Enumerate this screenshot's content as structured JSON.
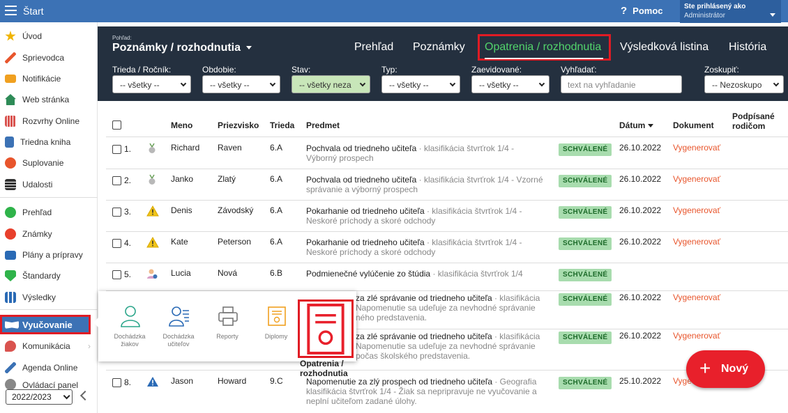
{
  "topbar": {
    "start": "Štart",
    "help": "Pomoc",
    "user_line1": "Ste prihlásený ako",
    "user_line2": "Administrátor"
  },
  "sidebar": {
    "items": [
      {
        "label": "Úvod",
        "icon": "star-icon",
        "color": "#f0b400"
      },
      {
        "label": "Sprievodca",
        "icon": "wand-icon",
        "color": "#e8552c"
      },
      {
        "label": "Notifikácie",
        "icon": "envelope-icon",
        "color": "#f0a020"
      },
      {
        "label": "Web stránka",
        "icon": "home-icon",
        "color": "#2e8b57"
      },
      {
        "label": "Rozvrhy Online",
        "icon": "timetable-icon",
        "color": "#d9534f"
      },
      {
        "label": "Triedna kniha",
        "icon": "book-icon",
        "color": "#3c72b5"
      },
      {
        "label": "Suplovanie",
        "icon": "user-swap-icon",
        "color": "#e8552c"
      },
      {
        "label": "Udalosti",
        "icon": "calendar-icon",
        "color": "#333"
      },
      {
        "label": "Prehľad",
        "icon": "check-circle-icon",
        "color": "#2fb34a"
      },
      {
        "label": "Známky",
        "icon": "grade-icon",
        "color": "#e8402c"
      },
      {
        "label": "Plány a prípravy",
        "icon": "briefcase-icon",
        "color": "#2a6ab5"
      },
      {
        "label": "Štandardy",
        "icon": "shield-check-icon",
        "color": "#2fb34a"
      },
      {
        "label": "Výsledky",
        "icon": "bar-chart-icon",
        "color": "#2a6ab5"
      },
      {
        "label": "Vyučovanie",
        "icon": "open-book-icon",
        "color": "#fff"
      },
      {
        "label": "Komunikácia",
        "icon": "chat-icon",
        "color": "#d9534f"
      },
      {
        "label": "Agenda Online",
        "icon": "pencil-icon",
        "color": "#3c72b5"
      },
      {
        "label": "Ovládací panel",
        "icon": "gear-icon",
        "color": "#888"
      }
    ],
    "year": "2022/2023"
  },
  "header": {
    "view_label": "Pohľad:",
    "view_title": "Poznámky / rozhodnutia",
    "tabs": [
      "Prehľad",
      "Poznámky",
      "Opatrenia / rozhodnutia",
      "Výsledková listina",
      "História"
    ],
    "filters": [
      {
        "label": "Trieda / Ročník:",
        "value": "-- všetky --"
      },
      {
        "label": "Obdobie:",
        "value": "-- všetky --"
      },
      {
        "label": "Stav:",
        "value": "-- všetky neza"
      },
      {
        "label": "Typ:",
        "value": "-- všetky --"
      },
      {
        "label": "Zaevidované:",
        "value": "-- všetky --"
      },
      {
        "label": "Vyhľadať:",
        "placeholder": "text na vyhľadanie"
      },
      {
        "label": "Zoskupiť:",
        "value": "-- Nezoskupo"
      }
    ]
  },
  "table": {
    "headers": {
      "name": "Meno",
      "surname": "Priezvisko",
      "class": "Trieda",
      "subject": "Predmet",
      "date": "Dátum",
      "doc": "Dokument",
      "signed1": "Podpísané",
      "signed2": "rodičom"
    },
    "rows": [
      {
        "n": "1.",
        "icon": "medal-icon",
        "name": "Richard",
        "surname": "Raven",
        "class": "6.A",
        "s1": "Pochvala od triedneho učiteľa",
        "s1g": " · klasifikácia štvrťrok 1/4 -",
        "s2": "",
        "s2g": "Výborný prospech",
        "s3g": "",
        "status": "SCHVÁLENÉ",
        "date": "26.10.2022",
        "doc": "Vygenerovať"
      },
      {
        "n": "2.",
        "icon": "medal-icon",
        "name": "Janko",
        "surname": "Zlatý",
        "class": "6.A",
        "s1": "Pochvala od triedneho učiteľa",
        "s1g": " · klasifikácia štvrťrok 1/4 - Vzorné",
        "s2": "",
        "s2g": "správanie a výborný prospech",
        "s3g": "",
        "status": "SCHVÁLENÉ",
        "date": "26.10.2022",
        "doc": "Vygenerovať"
      },
      {
        "n": "3.",
        "icon": "warning-icon",
        "name": "Denis",
        "surname": "Závodský",
        "class": "6.A",
        "s1": "Pokarhanie od triedneho učiteľa",
        "s1g": " · klasifikácia štvrťrok 1/4 -",
        "s2": "",
        "s2g": "Neskoré príchody a skoré odchody",
        "s3g": "",
        "status": "SCHVÁLENÉ",
        "date": "26.10.2022",
        "doc": "Vygenerovať"
      },
      {
        "n": "4.",
        "icon": "warning-icon",
        "name": "Kate",
        "surname": "Peterson",
        "class": "6.A",
        "s1": "Pokarhanie od triedneho učiteľa",
        "s1g": " · klasifikácia štvrťrok 1/4 -",
        "s2": "",
        "s2g": "Neskoré príchody a skoré odchody",
        "s3g": "",
        "status": "SCHVÁLENÉ",
        "date": "26.10.2022",
        "doc": "Vygenerovať"
      },
      {
        "n": "5.",
        "icon": "user-flag-icon",
        "name": "Lucia",
        "surname": "Nová",
        "class": "6.B",
        "s1": "Podmienečné vylúčenie zo štúdia",
        "s1g": " · klasifikácia štvrťrok 1/4",
        "s2": "",
        "s2g": "",
        "s3g": "",
        "status": "SCHVÁLENÉ",
        "date": "",
        "doc": ""
      },
      {
        "n": "",
        "icon": "",
        "name": "",
        "surname": "",
        "class": "",
        "s1": "za zlé správanie od triedneho učiteľa",
        "s1g": " · klasifikácia",
        "s2": "",
        "s2g": "Napomenutie sa udeľuje za nevhodné správanie",
        "s3g": "ného predstavenia.",
        "status": "SCHVÁLENÉ",
        "date": "26.10.2022",
        "doc": "Vygenerovať"
      },
      {
        "n": "",
        "icon": "",
        "name": "",
        "surname": "",
        "class": "",
        "s1": "za zlé správanie od triedneho učiteľa",
        "s1g": " · klasifikácia",
        "s2": "",
        "s2g": "Napomenutie sa udeľuje za nevhodné správanie",
        "s3g": "počas školského predstavenia.",
        "status": "SCHVÁLENÉ",
        "date": "26.10.2022",
        "doc": "Vygenerovať"
      },
      {
        "n": "8.",
        "icon": "warning-blue-icon",
        "name": "Jason",
        "surname": "Howard",
        "class": "9.C",
        "s1": "Napomenutie za zlý prospech od triedneho učiteľa",
        "s1g": " · Geografia",
        "s2": "",
        "s2g": "klasifikácia štvrťrok 1/4 - Žiak sa nepripravuje ne vyučovanie a",
        "s3g": "neplní učiteľom zadané úlohy.",
        "status": "SCHVÁLENÉ",
        "date": "25.10.2022",
        "doc": "Vyge"
      }
    ]
  },
  "popup": {
    "items": [
      {
        "label1": "Dochádzka",
        "label2": "žiakov",
        "icon": "student-attendance-icon"
      },
      {
        "label1": "Dochádzka",
        "label2": "učiteľov",
        "icon": "teacher-attendance-icon"
      },
      {
        "label1": "Reporty",
        "label2": "",
        "icon": "printer-icon"
      },
      {
        "label1": "Diplomy",
        "label2": "",
        "icon": "diploma-icon"
      },
      {
        "label1": "Opatrenia /",
        "label2": "rozhodnutia",
        "icon": "decision-document-icon"
      }
    ]
  },
  "new_button": "Nový",
  "colors": {
    "topbar": "#3c72b5",
    "header": "#24303f",
    "accent_green": "#52d46b",
    "highlight_red": "#e01b24",
    "link_orange": "#e8552c"
  }
}
